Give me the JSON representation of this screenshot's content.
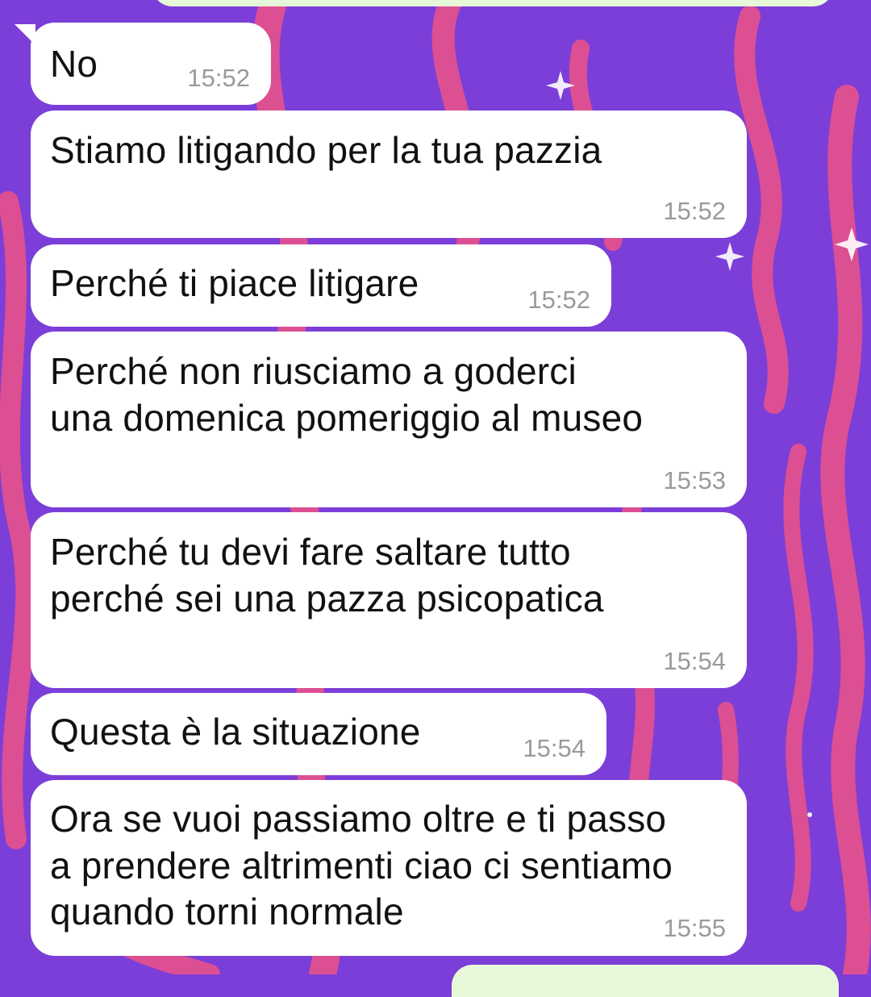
{
  "chat": {
    "messages": [
      {
        "text": [
          "No"
        ],
        "time": "15:52"
      },
      {
        "text": [
          "Stiamo litigando per la tua pazzia"
        ],
        "time": "15:52"
      },
      {
        "text": [
          "Perché ti piace litigare"
        ],
        "time": "15:52"
      },
      {
        "text": [
          "Perché non riusciamo a goderci",
          "una domenica pomeriggio al museo"
        ],
        "time": "15:53"
      },
      {
        "text": [
          "Perché tu devi fare saltare tutto",
          "perché sei una pazza psicopatica"
        ],
        "time": "15:54"
      },
      {
        "text": [
          "Questa è la situazione"
        ],
        "time": "15:54"
      },
      {
        "text": [
          "Ora se vuoi passiamo oltre e ti passo",
          "a prendere altrimenti ciao ci sentiamo",
          "quando torni normale"
        ],
        "time": "15:55"
      }
    ]
  },
  "theme": {
    "wallpaper_color": "#7c3ed8",
    "wallpaper_flame_color": "#e2508f",
    "incoming_bubble_color": "#ffffff",
    "outgoing_bubble_color": "#e7f9d9",
    "time_color": "#9a9a9a"
  }
}
